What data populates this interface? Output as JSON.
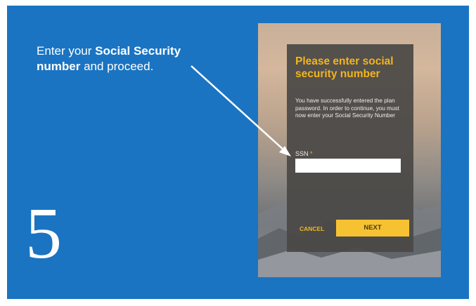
{
  "instruction": {
    "prefix": "Enter your ",
    "bold": "Social Security number",
    "suffix": " and proceed."
  },
  "step_number": "5",
  "dialog": {
    "title": "Please enter social security number",
    "body": "You have successfully entered the plan password. In order to continue, you must now enter your Social Security Number",
    "ssn_label": "SSN",
    "required_marker": "*",
    "ssn_value": "",
    "cancel_label": "CANCEL",
    "next_label": "NEXT"
  },
  "colors": {
    "panel_blue": "#1a74c2",
    "accent_yellow": "#f6c232",
    "title_orange": "#f4b51a",
    "dialog_gray": "#4a4846"
  }
}
